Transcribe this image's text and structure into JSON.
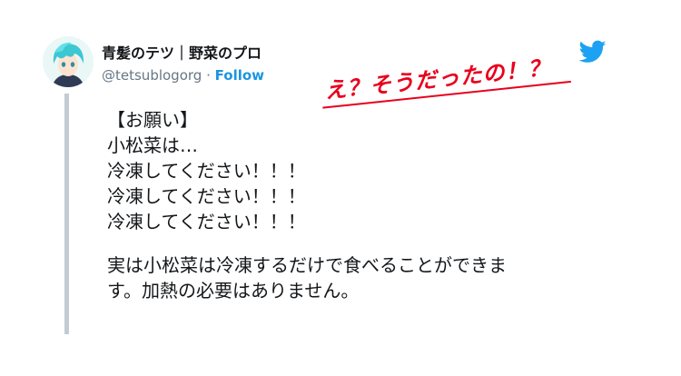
{
  "tweet": {
    "display_name": "青髪のテツ｜野菜のプロ",
    "handle": "@tetsublogorg",
    "separator": " · ",
    "follow_label": "Follow",
    "body_lines": [
      "【お願い】",
      "小松菜は…",
      "冷凍してください！！！",
      "冷凍してください！！！",
      "冷凍してください！！！"
    ],
    "body_paragraph_lines": [
      "実は小松菜は冷凍するだけで食べることができま",
      "す。加熱の必要はありません。"
    ]
  },
  "annotation": {
    "text": "え？そうだったの！？",
    "color": "#e8001c"
  },
  "colors": {
    "brand_blue": "#1da1f2",
    "follow_blue": "#1b95e0",
    "thread_line": "#c4cbd1"
  },
  "icons": {
    "avatar": "avatar-image",
    "brand": "twitter-bird-icon"
  }
}
